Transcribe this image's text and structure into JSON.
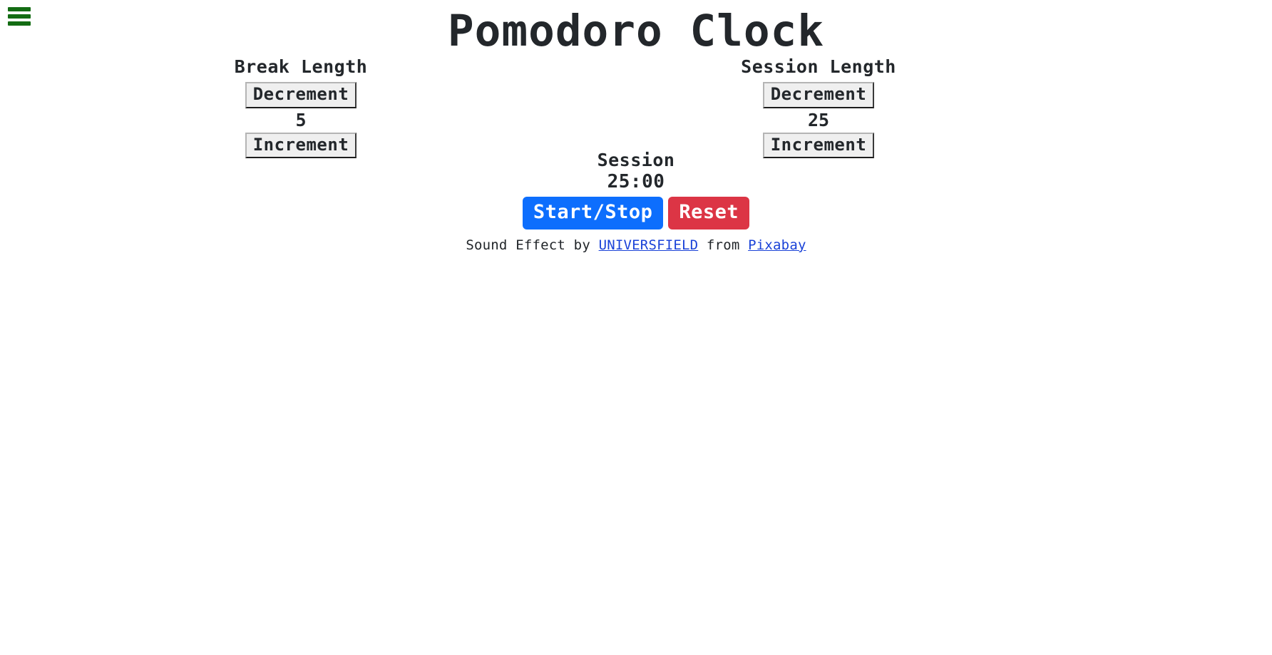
{
  "header": {
    "menu_icon": "hamburger-menu-icon",
    "menu_color": "#136c13",
    "title": "Pomodoro Clock"
  },
  "break": {
    "label": "Break Length",
    "decrement_label": "Decrement",
    "increment_label": "Increment",
    "value": "5"
  },
  "session": {
    "label": "Session Length",
    "decrement_label": "Decrement",
    "increment_label": "Increment",
    "value": "25"
  },
  "timer": {
    "label": "Session",
    "time_left": "25:00",
    "start_stop_label": "Start/Stop",
    "reset_label": "Reset",
    "start_color": "#0d6efd",
    "reset_color": "#dc3545"
  },
  "attribution": {
    "prefix": "Sound Effect by ",
    "author_link": "UNIVERSFIELD",
    "middle": " from ",
    "source_link": "Pixabay",
    "link_color": "#1a42d8"
  }
}
